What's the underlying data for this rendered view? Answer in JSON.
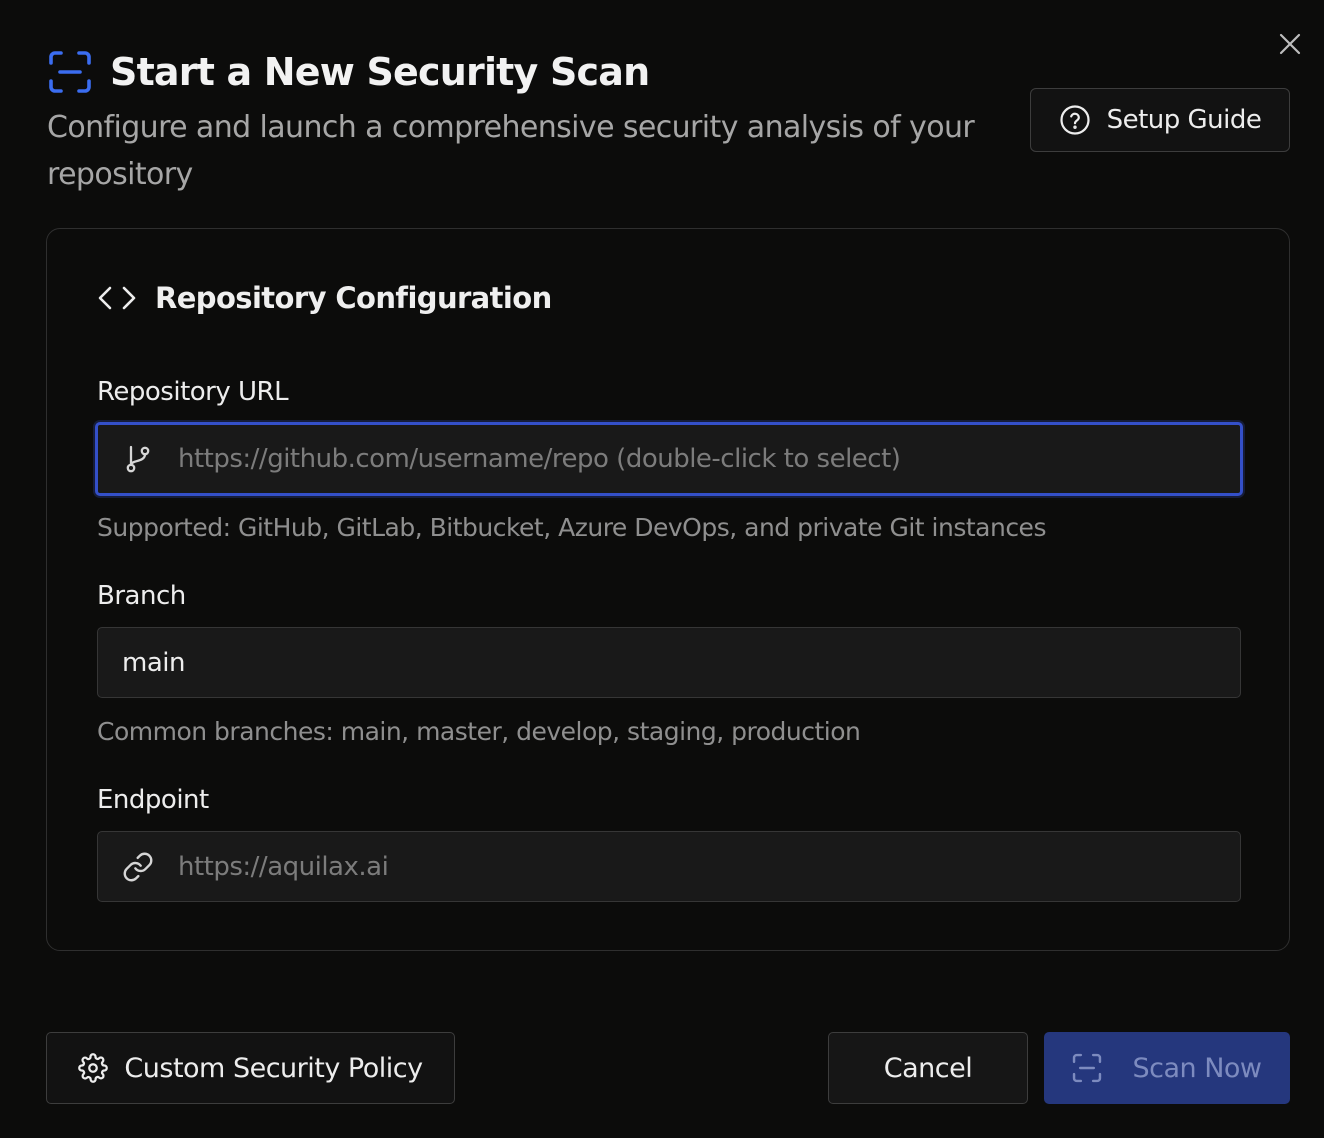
{
  "header": {
    "title": "Start a New Security Scan",
    "subtitle": "Configure and launch a comprehensive security analysis of your repository",
    "setup_guide_label": "Setup Guide"
  },
  "section": {
    "title": "Repository Configuration"
  },
  "fields": {
    "repo_url": {
      "label": "Repository URL",
      "value": "",
      "placeholder": "https://github.com/username/repo (double-click to select)",
      "hint": "Supported: GitHub, GitLab, Bitbucket, Azure DevOps, and private Git instances"
    },
    "branch": {
      "label": "Branch",
      "value": "main",
      "placeholder": "",
      "hint": "Common branches: main, master, develop, staging, production"
    },
    "endpoint": {
      "label": "Endpoint",
      "value": "",
      "placeholder": "https://aquilax.ai"
    }
  },
  "footer": {
    "policy_label": "Custom Security Policy",
    "cancel_label": "Cancel",
    "scan_label": "Scan Now"
  },
  "colors": {
    "accent": "#3450c9",
    "scan_button_bg": "#25377d",
    "icon_blue": "#3b6df0"
  },
  "icons": {
    "close": "close-icon",
    "title": "scan-icon",
    "setup_guide": "help-circle-icon",
    "section": "code-icon",
    "repo_url": "git-branch-icon",
    "endpoint": "link-icon",
    "policy": "gear-icon",
    "scan": "scan-icon"
  }
}
